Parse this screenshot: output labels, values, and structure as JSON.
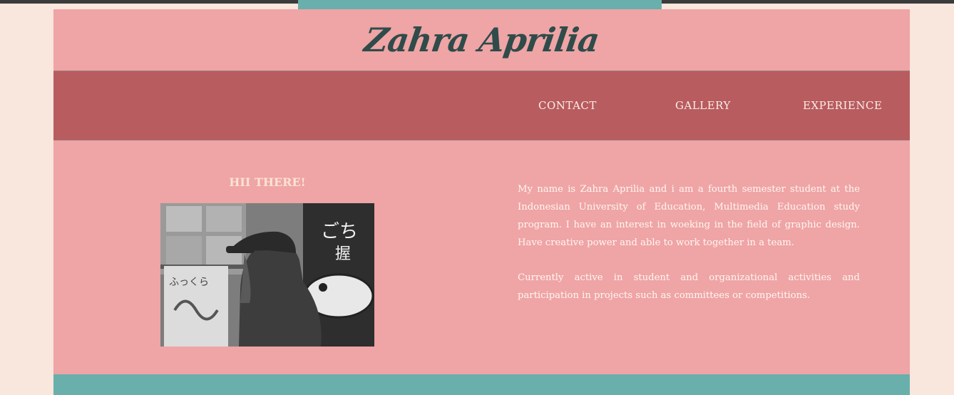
{
  "site": {
    "logo_text": "Zahra Aprilia"
  },
  "nav": {
    "items": [
      {
        "label": "CONTACT"
      },
      {
        "label": "GALLERY"
      },
      {
        "label": "EXPERIENCE"
      }
    ]
  },
  "main": {
    "greeting": "HII THERE!",
    "bio": [
      "My name is Zahra Aprilia and i am a fourth semester student at the Indonesian University of Education, Multimedia Education study program. I have an interest in woeking in the field of graphic design. Have creative power and able to work together in a team.",
      "Currently active in student and organizational activities and participation in projects such as committees or competitions."
    ]
  },
  "colors": {
    "background": "#f9e6dc",
    "page_pink": "#efa4a5",
    "nav_red": "#b85c60",
    "accent_teal": "#69afac",
    "logo_dark": "#2f4b4a"
  }
}
